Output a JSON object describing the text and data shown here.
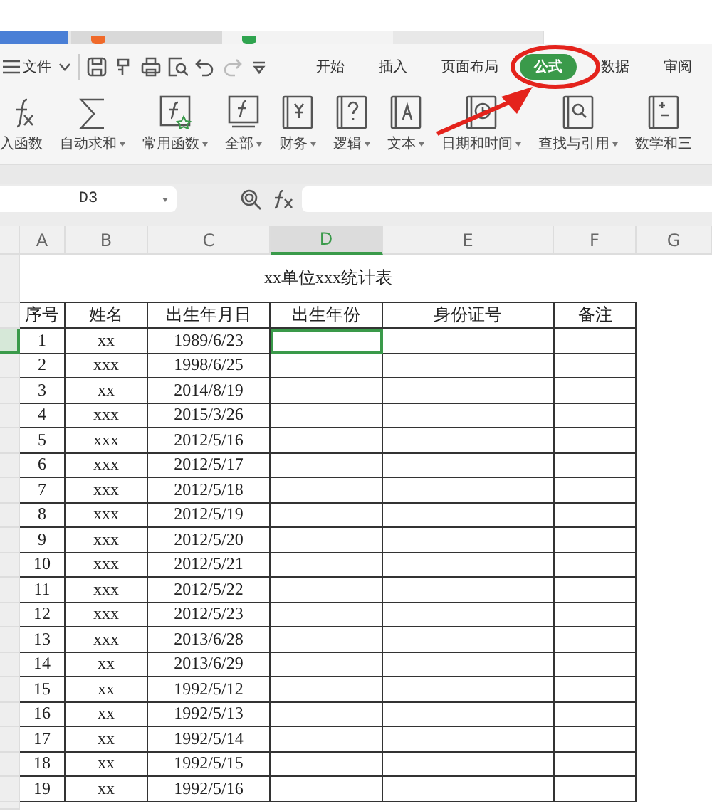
{
  "menu": {
    "file": "文件"
  },
  "tabs": [
    {
      "label": "开始",
      "selected": false
    },
    {
      "label": "插入",
      "selected": false
    },
    {
      "label": "页面布局",
      "selected": false
    },
    {
      "label": "公式",
      "selected": true
    },
    {
      "label": "数据",
      "selected": false
    },
    {
      "label": "审阅",
      "selected": false
    }
  ],
  "ribbon": [
    {
      "label": "入函数",
      "dropdown": false
    },
    {
      "label": "自动求和",
      "dropdown": true
    },
    {
      "label": "常用函数",
      "dropdown": true
    },
    {
      "label": "全部",
      "dropdown": true
    },
    {
      "label": "财务",
      "dropdown": true
    },
    {
      "label": "逻辑",
      "dropdown": true
    },
    {
      "label": "文本",
      "dropdown": true
    },
    {
      "label": "日期和时间",
      "dropdown": true
    },
    {
      "label": "查找与引用",
      "dropdown": true
    },
    {
      "label": "数学和三",
      "dropdown": false
    }
  ],
  "formula_bar": {
    "cell_ref": "D3"
  },
  "columns": [
    {
      "label": "A",
      "selected": false
    },
    {
      "label": "B",
      "selected": false
    },
    {
      "label": "C",
      "selected": false
    },
    {
      "label": "D",
      "selected": true
    },
    {
      "label": "E",
      "selected": false
    },
    {
      "label": "F",
      "selected": false
    },
    {
      "label": "G",
      "selected": false
    }
  ],
  "sheet": {
    "title": "xx单位xxx统计表",
    "headers": [
      "序号",
      "姓名",
      "出生年月日",
      "出生年份",
      "身份证号",
      "备注"
    ],
    "rows": [
      {
        "cells": [
          "1",
          "xx",
          "1989/6/23"
        ],
        "active": true
      },
      {
        "cells": [
          "2",
          "xxx",
          "1998/6/25"
        ],
        "active": false
      },
      {
        "cells": [
          "3",
          "xx",
          "2014/8/19"
        ],
        "active": false
      },
      {
        "cells": [
          "4",
          "xxx",
          "2015/3/26"
        ],
        "active": false
      },
      {
        "cells": [
          "5",
          "xxx",
          "2012/5/16"
        ],
        "active": false
      },
      {
        "cells": [
          "6",
          "xxx",
          "2012/5/17"
        ],
        "active": false
      },
      {
        "cells": [
          "7",
          "xxx",
          "2012/5/18"
        ],
        "active": false
      },
      {
        "cells": [
          "8",
          "xxx",
          "2012/5/19"
        ],
        "active": false
      },
      {
        "cells": [
          "9",
          "xxx",
          "2012/5/20"
        ],
        "active": false
      },
      {
        "cells": [
          "10",
          "xxx",
          "2012/5/21"
        ],
        "active": false
      },
      {
        "cells": [
          "11",
          "xxx",
          "2012/5/22"
        ],
        "active": false
      },
      {
        "cells": [
          "12",
          "xxx",
          "2012/5/23"
        ],
        "active": false
      },
      {
        "cells": [
          "13",
          "xxx",
          "2013/6/28"
        ],
        "active": false
      },
      {
        "cells": [
          "14",
          "xx",
          "2013/6/29"
        ],
        "active": false
      },
      {
        "cells": [
          "15",
          "xx",
          "1992/5/12"
        ],
        "active": false
      },
      {
        "cells": [
          "16",
          "xx",
          "1992/5/13"
        ],
        "active": false
      },
      {
        "cells": [
          "17",
          "xx",
          "1992/5/14"
        ],
        "active": false
      },
      {
        "cells": [
          "18",
          "xx",
          "1992/5/15"
        ],
        "active": false
      },
      {
        "cells": [
          "19",
          "xx",
          "1992/5/16"
        ],
        "active": false
      }
    ]
  }
}
